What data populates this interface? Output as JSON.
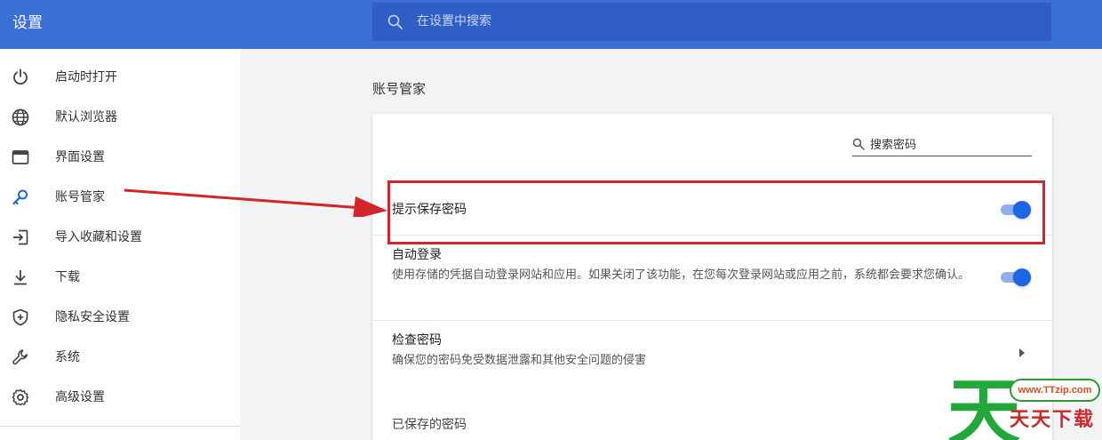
{
  "app": {
    "title": "设置"
  },
  "search": {
    "placeholder": "在设置中搜索"
  },
  "sidebar": {
    "items": [
      {
        "label": "启动时打开",
        "icon": "power-icon"
      },
      {
        "label": "默认浏览器",
        "icon": "globe-icon"
      },
      {
        "label": "界面设置",
        "icon": "window-icon"
      },
      {
        "label": "账号管家",
        "icon": "key-icon"
      },
      {
        "label": "导入收藏和设置",
        "icon": "import-icon"
      },
      {
        "label": "下载",
        "icon": "download-icon"
      },
      {
        "label": "隐私安全设置",
        "icon": "shield-icon"
      },
      {
        "label": "系统",
        "icon": "wrench-icon"
      },
      {
        "label": "高级设置",
        "icon": "gear-icon"
      }
    ],
    "active_index": 3
  },
  "main": {
    "section_title": "账号管家",
    "password_search": {
      "placeholder": "搜索密码"
    },
    "rows": [
      {
        "title": "提示保存密码",
        "toggle": true
      },
      {
        "title": "自动登录",
        "description": "使用存储的凭据自动登录网站和应用。如果关闭了该功能，在您每次登录网站或应用之前，系统都会要求您确认。",
        "toggle": true
      },
      {
        "title": "检查密码",
        "description": "确保您的密码免受数据泄露和其他安全问题的侵害"
      }
    ],
    "saved_passwords_label": "已保存的密码"
  },
  "watermark": {
    "url": "www.TTzip.com",
    "text": "天天下载",
    "logo_glyph": "天"
  },
  "colors": {
    "header": "#3b6fd8",
    "accent": "#1a66e6",
    "annotation": "#d3262b"
  }
}
